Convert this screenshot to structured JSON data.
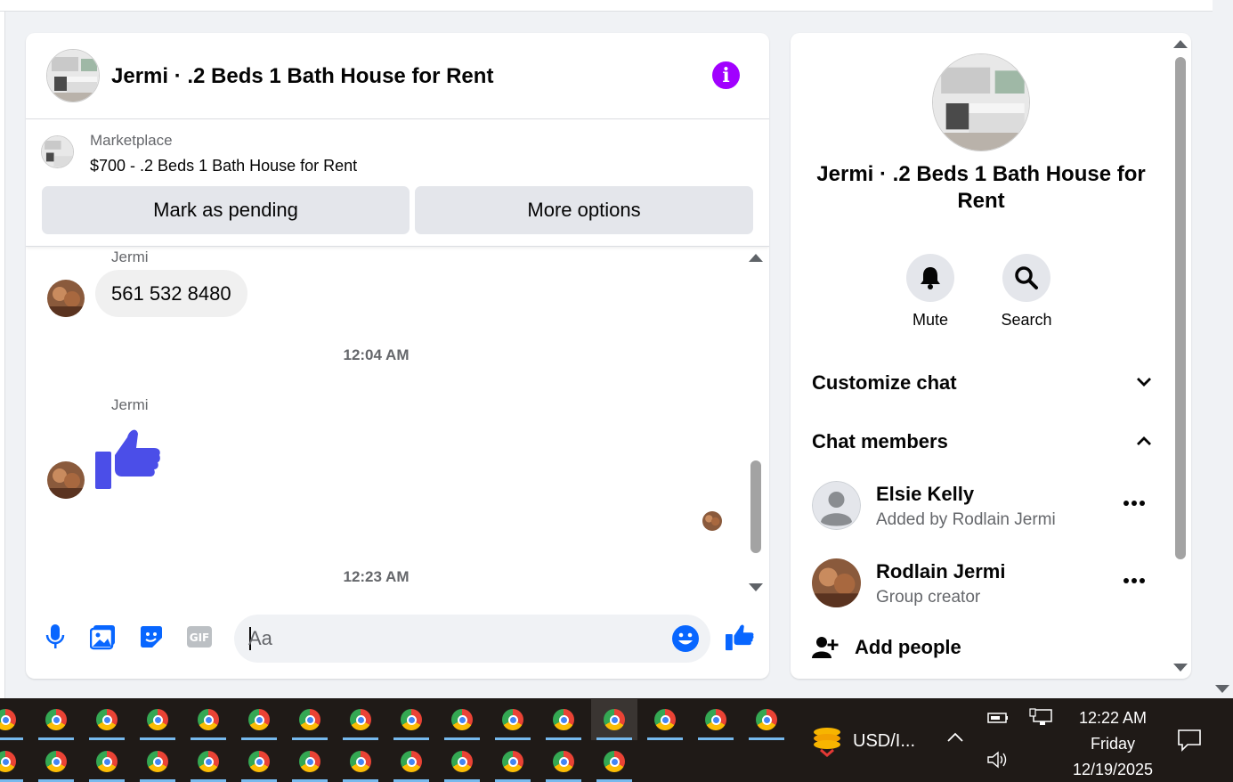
{
  "chat": {
    "title": "Jermi · .2 Beds 1 Bath House for Rent",
    "marketplace": {
      "label": "Marketplace",
      "listing": "$700 - .2 Beds 1 Bath House for Rent",
      "pending_button": "Mark as pending",
      "more_button": "More options"
    },
    "messages": [
      {
        "sender": "Jermi",
        "text": "561 532 8480"
      },
      {
        "timestamp": "12:04 AM"
      },
      {
        "sender": "Jermi",
        "sticker": "thumbs-up"
      },
      {
        "timestamp": "12:23 AM"
      }
    ],
    "composer": {
      "placeholder": "Aa"
    }
  },
  "info_panel": {
    "title": "Jermi · .2 Beds 1 Bath House for Rent",
    "actions": [
      {
        "label": "Mute",
        "icon": "bell-icon"
      },
      {
        "label": "Search",
        "icon": "search-icon"
      }
    ],
    "customize_chat": "Customize chat",
    "chat_members": "Chat members",
    "members": [
      {
        "name": "Elsie Kelly",
        "sub": "Added by Rodlain Jermi"
      },
      {
        "name": "Rodlain Jermi",
        "sub": "Group creator"
      }
    ],
    "add_people": "Add people"
  },
  "taskbar": {
    "currency": "USD/I...",
    "time": "12:22 AM",
    "day": "Friday",
    "date": "12/19/2025"
  },
  "colors": {
    "accent": "#0866ff",
    "info": "#a100ff",
    "sticker": "#4b4ee8"
  }
}
